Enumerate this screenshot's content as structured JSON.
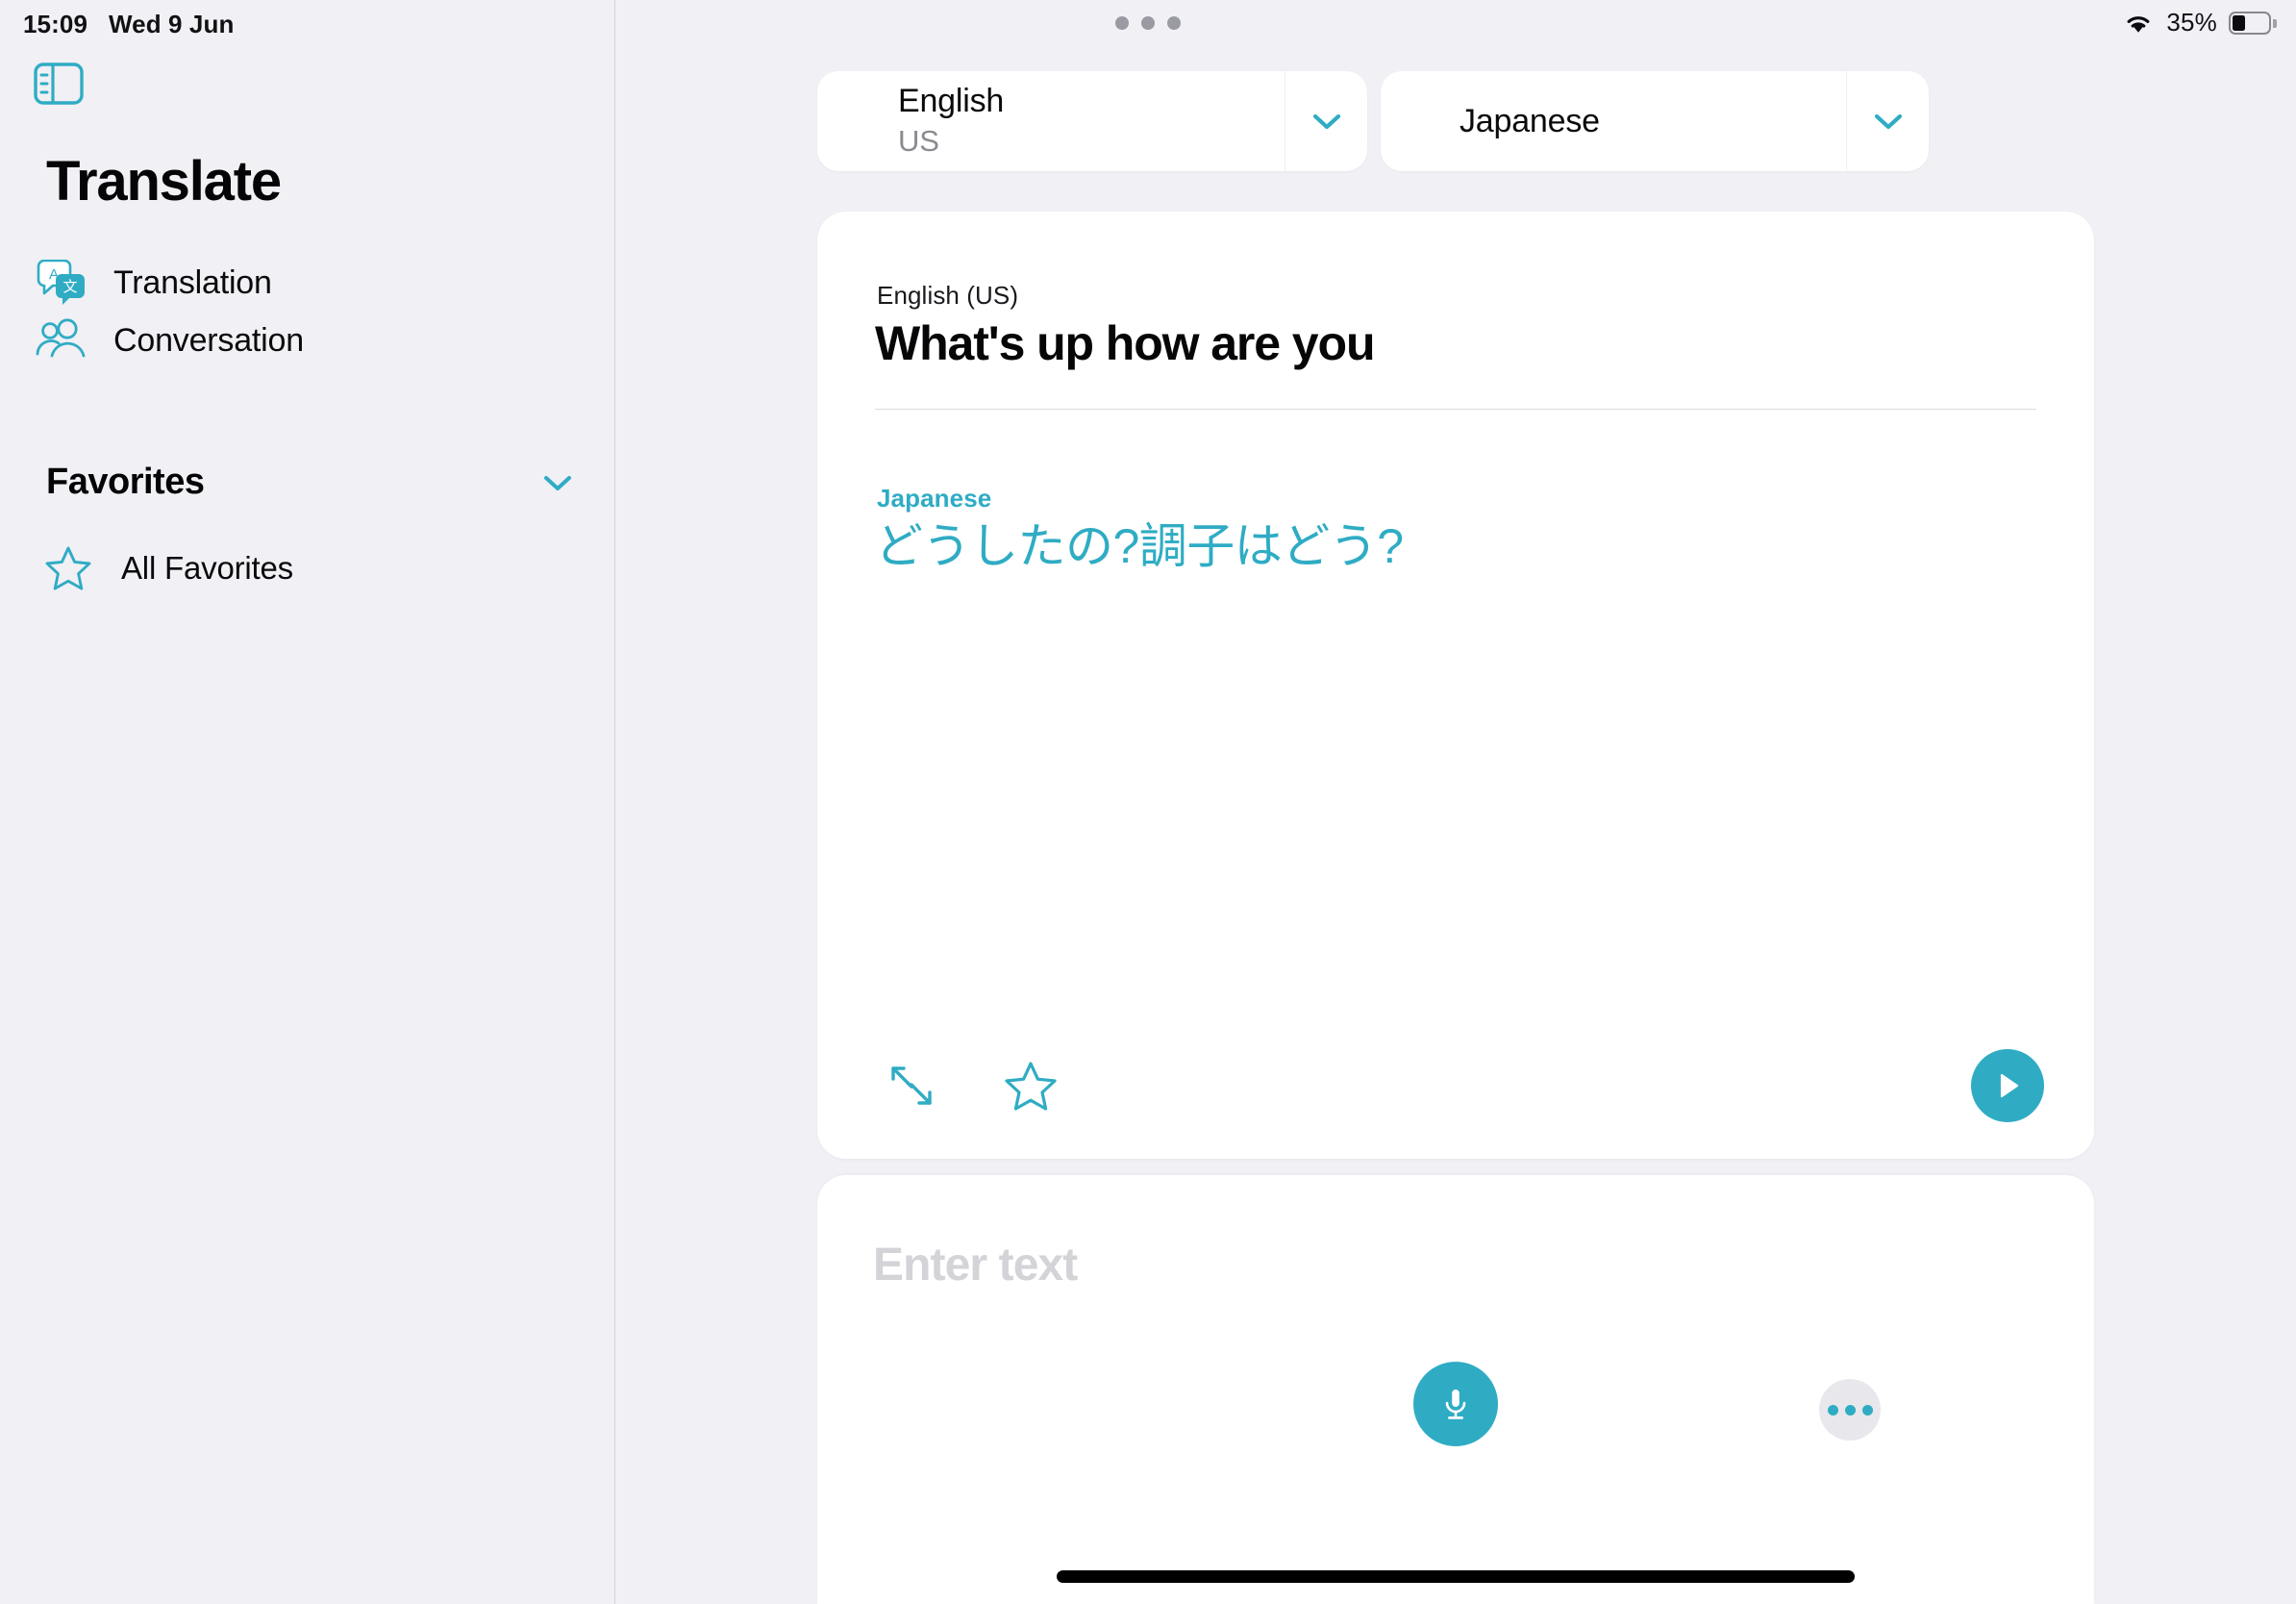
{
  "status_bar": {
    "time": "15:09",
    "date": "Wed 9 Jun",
    "battery_percent": "35%",
    "battery_level": 35,
    "wifi_icon": "wifi-icon",
    "battery_icon": "battery-icon",
    "window_dots_icon": "window-drag-handle-dots"
  },
  "sidebar": {
    "toggle_icon": "sidebar-toggle-icon",
    "title": "Translate",
    "items": [
      {
        "label": "Translation",
        "icon": "translation-bubbles-icon"
      },
      {
        "label": "Conversation",
        "icon": "two-people-icon"
      }
    ],
    "favorites": {
      "title": "Favorites",
      "chevron_icon": "chevron-down-icon",
      "items": [
        {
          "label": "All Favorites",
          "icon": "star-outline-icon"
        }
      ]
    }
  },
  "language_bar": {
    "source": {
      "name": "English",
      "region": "US",
      "chevron_icon": "chevron-down-icon"
    },
    "target": {
      "name": "Japanese",
      "region": "",
      "chevron_icon": "chevron-down-icon"
    }
  },
  "translation_card": {
    "source_language_label": "English (US)",
    "source_text": "What's up how are you",
    "target_language_label": "Japanese",
    "target_text": "どうしたの?調子はどう?",
    "actions": [
      {
        "name": "expand-icon",
        "label": "Expand"
      },
      {
        "name": "star-outline-icon",
        "label": "Favorite"
      }
    ],
    "play_icon": "play-icon"
  },
  "input_card": {
    "placeholder": "Enter text",
    "value": "",
    "mic_icon": "microphone-icon",
    "more_icon": "more-ellipsis-icon"
  },
  "colors": {
    "accent": "#2FACC4",
    "background": "#F1F0F5",
    "card": "#FFFFFF",
    "text_primary": "#060608",
    "text_muted": "#8A8A90",
    "placeholder": "#D3D3D8",
    "more_button_bg": "#E8E7EC"
  }
}
